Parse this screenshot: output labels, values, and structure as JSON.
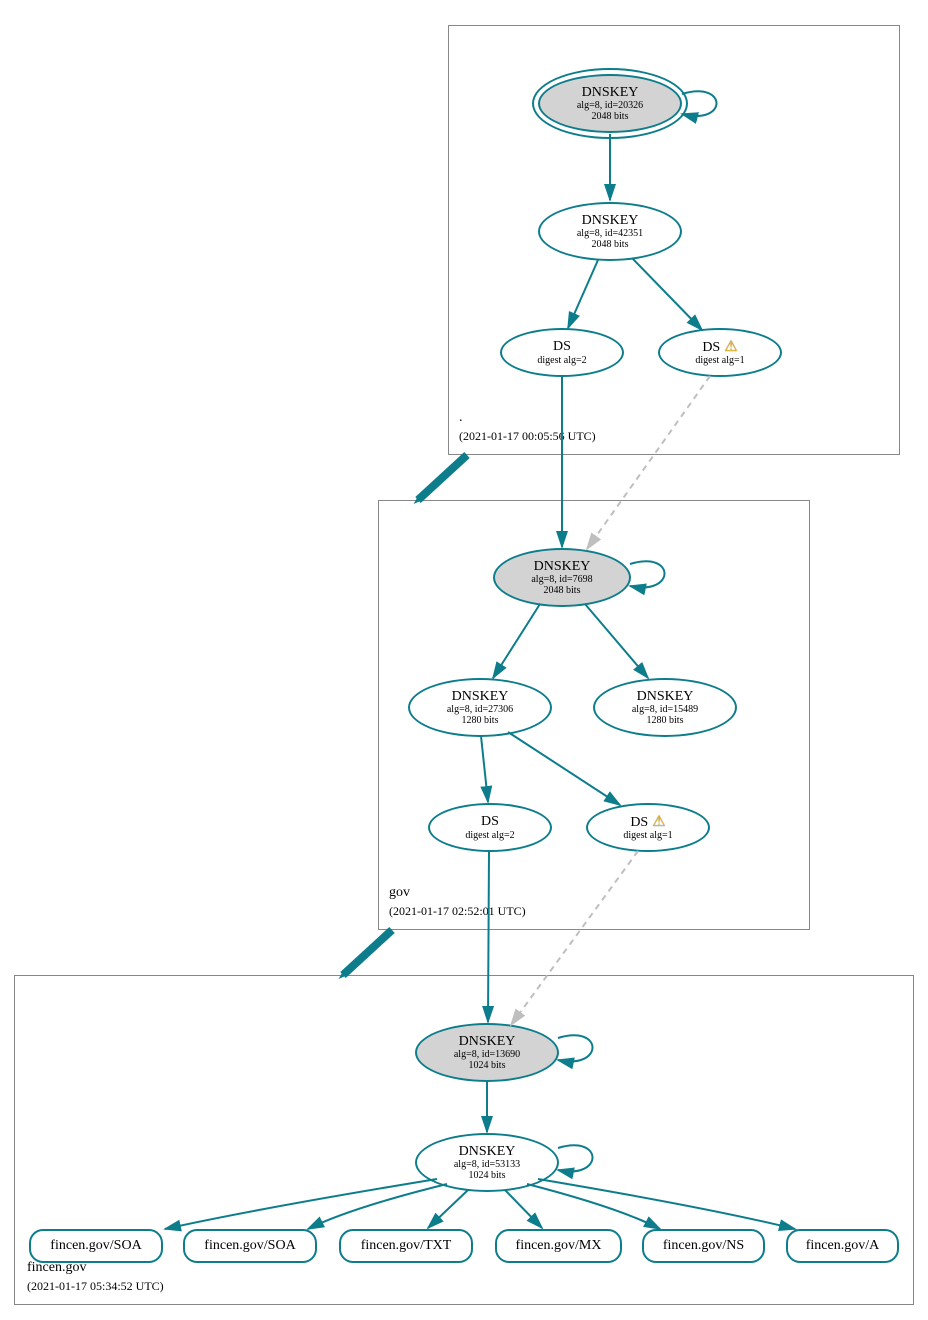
{
  "zones": {
    "root": {
      "label": ".",
      "date": "(2021-01-17 00:05:56 UTC)"
    },
    "gov": {
      "label": "gov",
      "date": "(2021-01-17 02:52:01 UTC)"
    },
    "fincen": {
      "label": "fincen.gov",
      "date": "(2021-01-17 05:34:52 UTC)"
    }
  },
  "nodes": {
    "root_ksk": {
      "title": "DNSKEY",
      "sub1": "alg=8, id=20326",
      "sub2": "2048 bits"
    },
    "root_zsk": {
      "title": "DNSKEY",
      "sub1": "alg=8, id=42351",
      "sub2": "2048 bits"
    },
    "root_ds2": {
      "title": "DS",
      "sub1": "digest alg=2"
    },
    "root_ds1": {
      "title": "DS",
      "sub1": "digest alg=1",
      "warn": true
    },
    "gov_ksk": {
      "title": "DNSKEY",
      "sub1": "alg=8, id=7698",
      "sub2": "2048 bits"
    },
    "gov_zsk1": {
      "title": "DNSKEY",
      "sub1": "alg=8, id=27306",
      "sub2": "1280 bits"
    },
    "gov_zsk2": {
      "title": "DNSKEY",
      "sub1": "alg=8, id=15489",
      "sub2": "1280 bits"
    },
    "gov_ds2": {
      "title": "DS",
      "sub1": "digest alg=2"
    },
    "gov_ds1": {
      "title": "DS",
      "sub1": "digest alg=1",
      "warn": true
    },
    "fin_ksk": {
      "title": "DNSKEY",
      "sub1": "alg=8, id=13690",
      "sub2": "1024 bits"
    },
    "fin_zsk": {
      "title": "DNSKEY",
      "sub1": "alg=8, id=53133",
      "sub2": "1024 bits"
    }
  },
  "rrsets": {
    "soa1": "fincen.gov/SOA",
    "soa2": "fincen.gov/SOA",
    "txt": "fincen.gov/TXT",
    "mx": "fincen.gov/MX",
    "ns": "fincen.gov/NS",
    "a": "fincen.gov/A"
  }
}
